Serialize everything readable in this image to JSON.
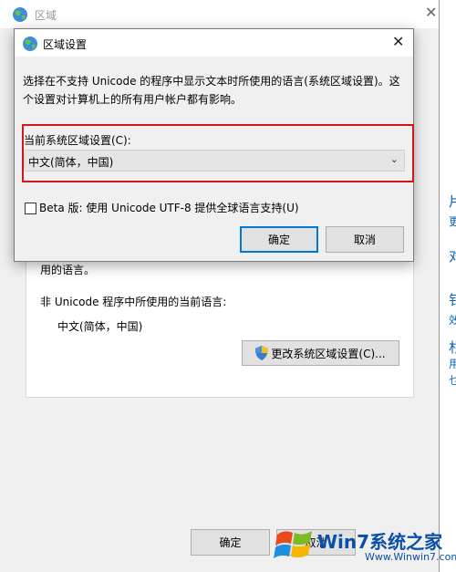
{
  "outer": {
    "title": "区域",
    "close": "✕",
    "partial_text": "用的语言。",
    "non_unicode_label": "非 Unicode 程序中所使用的当前语言:",
    "current_language": "中文(简体，中国)",
    "change_button": "更改系统区域设置(C)...",
    "ok": "确定",
    "cancel": "取消",
    "right_glyphs": [
      "片",
      "更",
      "对",
      "钅",
      "效",
      "杉",
      "用",
      "乜"
    ]
  },
  "dialog": {
    "title": "区域设置",
    "close": "✕",
    "description": "选择在不支持 Unicode 的程序中显示文本时所使用的语言(系统区域设置)。这个设置对计算机上的所有用户帐户都有影响。",
    "combo_label": "当前系统区域设置(C):",
    "combo_value": "中文(简体，中国)",
    "beta_label": "Beta 版: 使用 Unicode UTF-8 提供全球语言支持(U)",
    "ok": "确定",
    "cancel": "取消"
  },
  "watermark": {
    "brand": "Win7系统之家",
    "url": "Www.Winwin7.com"
  },
  "colors": {
    "accent": "#0078d7",
    "highlight": "#d41616",
    "desktop": "#0a6ab8"
  }
}
